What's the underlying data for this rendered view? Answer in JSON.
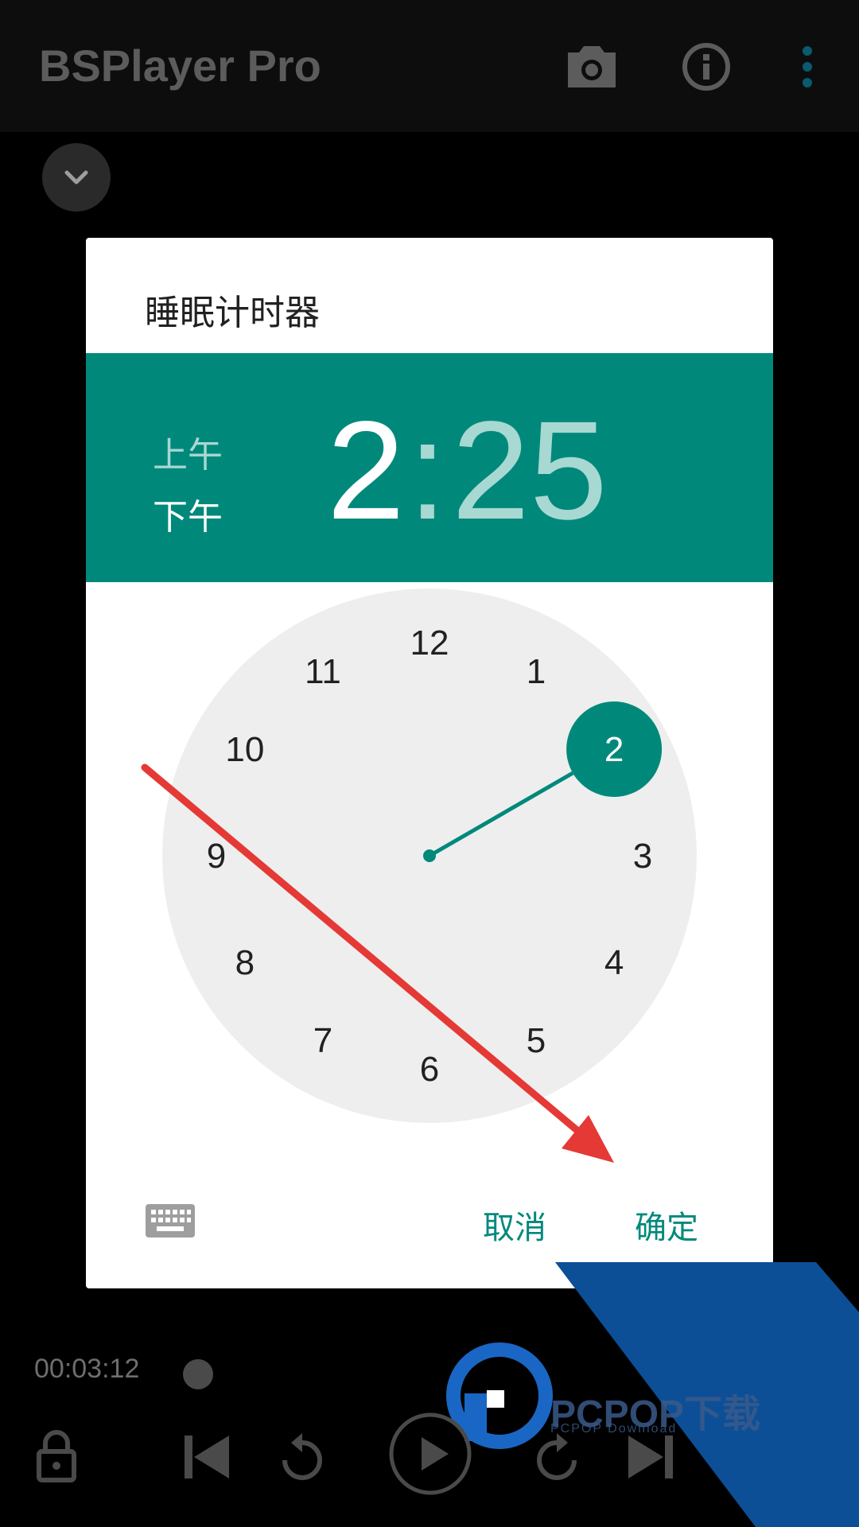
{
  "app_bar": {
    "title": "BSPlayer Pro",
    "icons": [
      "camera-icon",
      "info-icon",
      "more-vert-icon"
    ]
  },
  "dialog": {
    "title": "睡眠计时器",
    "am_label": "上午",
    "pm_label": "下午",
    "selected_period": "pm",
    "hour": "2",
    "colon": ":",
    "minutes": "25",
    "clock_numbers": [
      "12",
      "1",
      "2",
      "3",
      "4",
      "5",
      "6",
      "7",
      "8",
      "9",
      "10",
      "11"
    ],
    "selected_hour": 2,
    "cancel_label": "取消",
    "ok_label": "确定",
    "keyboard_icon": "keyboard-icon"
  },
  "player": {
    "elapsed": "00:03:12",
    "controls": [
      "lock-icon",
      "skip-previous-icon",
      "replay-icon",
      "play-icon",
      "redo-icon",
      "skip-next-icon"
    ]
  },
  "watermark": {
    "text": "PCPOP下载",
    "sub": "PCPOP Download"
  },
  "colors": {
    "accent": "#00897b",
    "annotation_arrow": "#e53935",
    "watermark_blue": "#0c4f96"
  }
}
